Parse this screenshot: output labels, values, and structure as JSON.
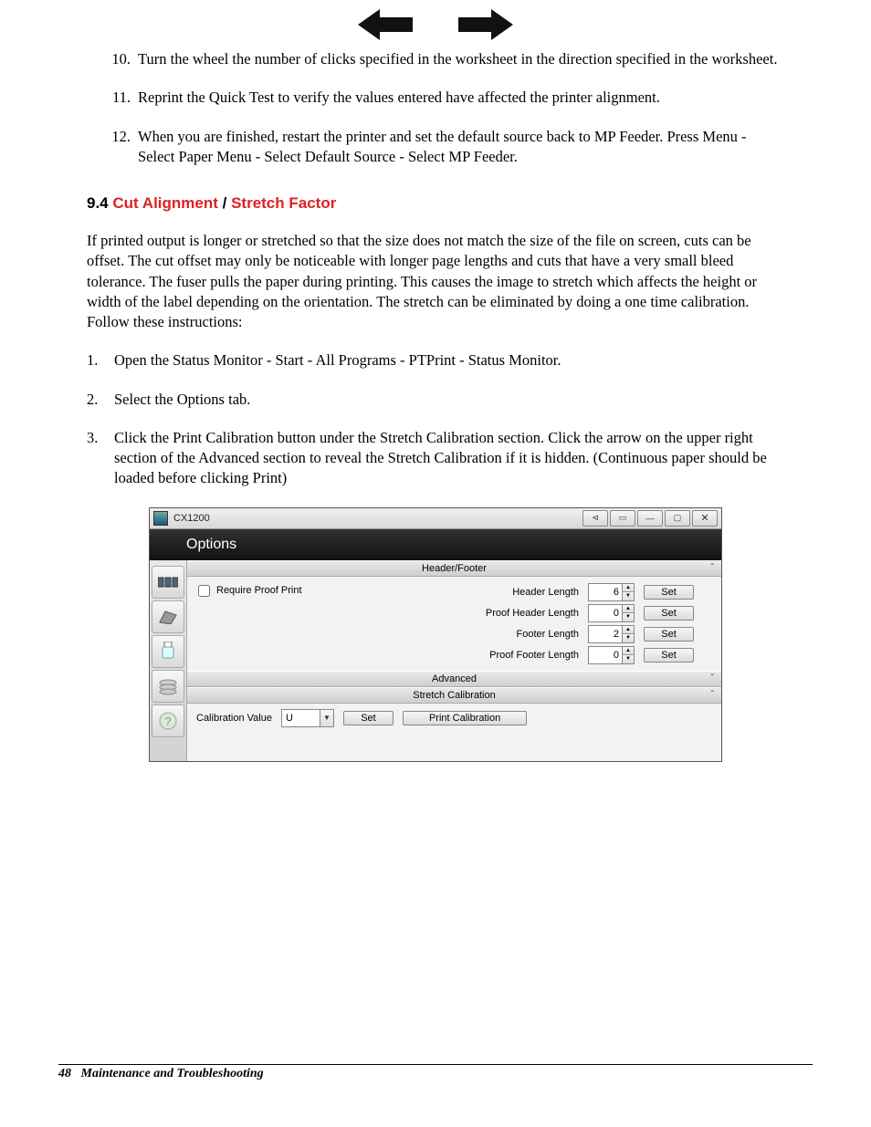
{
  "steps_top": [
    {
      "n": "10.",
      "t": "Turn the wheel the number of clicks specified in the worksheet in the direction specified in the worksheet."
    },
    {
      "n": "11.",
      "t": "Reprint the Quick Test to verify the values entered have affected the printer alignment."
    },
    {
      "n": "12.",
      "t": "When you are finished, restart the printer and set the default source back to MP Feeder. Press Menu - Select Paper Menu - Select Default Source - Select MP Feeder."
    }
  ],
  "section": {
    "num": "9.4",
    "red1": "Cut Alignment",
    "slash": " / ",
    "red2": "Stretch Factor"
  },
  "para": "If printed output is longer or stretched so that the size does not match the size of the file on screen, cuts can be offset. The cut offset may only be noticeable with longer page lengths and cuts that have a very small bleed tolerance.  The fuser pulls the paper during printing. This causes the image to stretch which affects the height or width of the label depending on the orientation. The stretch can be eliminated by doing a one time calibration.  Follow these instructions:",
  "steps_sub": [
    {
      "n": "1.",
      "t": "Open the Status Monitor - Start - All Programs - PTPrint - Status Monitor."
    },
    {
      "n": "2.",
      "t": "Select the Options tab."
    },
    {
      "n": "3.",
      "t": "Click the Print Calibration button under the Stretch Calibration section.  Click the arrow on the upper right section of the Advanced section to reveal the Stretch Calibration if it is hidden.  (Continuous paper should be loaded before clicking Print)"
    }
  ],
  "app": {
    "title": "CX1200",
    "options_label": "Options",
    "headers": {
      "hf": "Header/Footer",
      "adv": "Advanced",
      "cal": "Stretch Calibration"
    },
    "require_proof": "Require Proof Print",
    "rows": [
      {
        "label": "Header Length",
        "value": "6"
      },
      {
        "label": "Proof Header Length",
        "value": "0"
      },
      {
        "label": "Footer Length",
        "value": "2"
      },
      {
        "label": "Proof Footer Length",
        "value": "0"
      }
    ],
    "set_label": "Set",
    "cal_label": "Calibration Value",
    "cal_value": "U",
    "print_cal": "Print Calibration"
  },
  "footer": {
    "page": "48",
    "title": "Maintenance and Troubleshooting"
  }
}
